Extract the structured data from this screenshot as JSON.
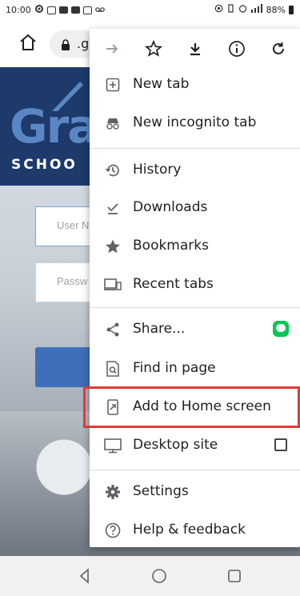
{
  "status_bar": {
    "time": "10:00",
    "battery": "88%"
  },
  "browser": {
    "url_fragment": ".g"
  },
  "webpage": {
    "logo_text": "Gra",
    "school_text": "SCHOO",
    "username_placeholder": "User N",
    "password_placeholder": "Passw"
  },
  "menu": {
    "items": [
      {
        "label": "New tab",
        "icon": "new-tab-icon"
      },
      {
        "label": "New incognito tab",
        "icon": "incognito-icon"
      },
      {
        "label": "History",
        "icon": "history-icon"
      },
      {
        "label": "Downloads",
        "icon": "downloads-icon"
      },
      {
        "label": "Bookmarks",
        "icon": "star-icon"
      },
      {
        "label": "Recent tabs",
        "icon": "recent-tabs-icon"
      },
      {
        "label": "Share...",
        "icon": "share-icon"
      },
      {
        "label": "Find in page",
        "icon": "find-icon"
      },
      {
        "label": "Add to Home screen",
        "icon": "add-to-home-icon"
      },
      {
        "label": "Desktop site",
        "icon": "desktop-icon"
      },
      {
        "label": "Settings",
        "icon": "gear-icon"
      },
      {
        "label": "Help & feedback",
        "icon": "help-icon"
      }
    ],
    "desktop_site_checked": false,
    "highlighted_item": "Add to Home screen"
  },
  "colors": {
    "highlight": "#e53935",
    "share_badge": "#00c853"
  }
}
